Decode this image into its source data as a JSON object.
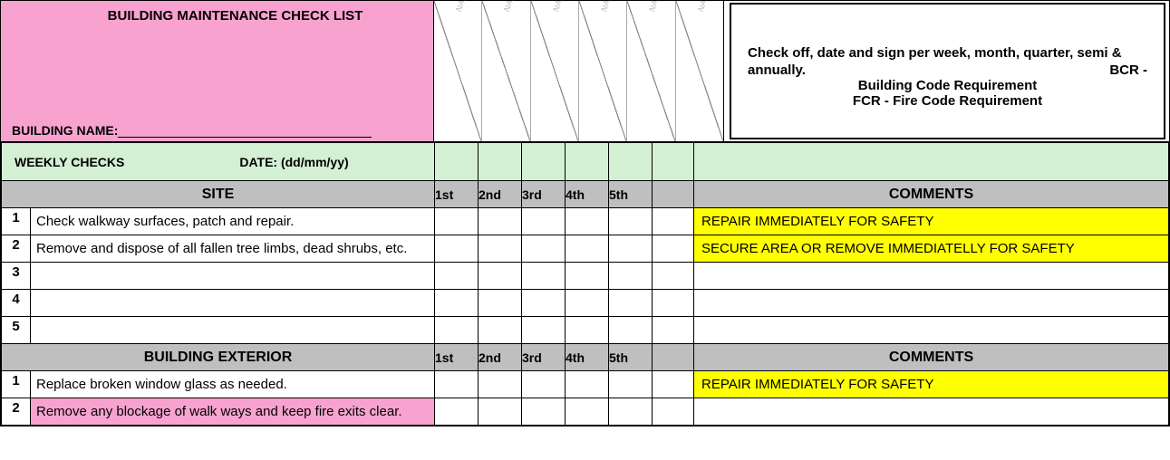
{
  "header": {
    "title": "BUILDING MAINTENANCE CHECK LIST",
    "building_name_label": "BUILDING NAME:",
    "diag_labels": [
      "NAME",
      "NAME",
      "NAME",
      "NAME",
      "NAME",
      "NAME"
    ],
    "info_line1": "Check off, date and sign per week, month, quarter, semi &",
    "info_line2a": "annually.",
    "info_line2b": "BCR -",
    "info_line3": "Building Code Requirement",
    "info_line4": "FCR - Fire Code Requirement"
  },
  "weekly": {
    "label": "WEEKLY CHECKS",
    "date_label": "DATE: (dd/mm/yy)"
  },
  "columns": {
    "c1": "1st",
    "c2": "2nd",
    "c3": "3rd",
    "c4": "4th",
    "c5": "5th",
    "comments": "COMMENTS"
  },
  "sections": [
    {
      "title": "SITE",
      "rows": [
        {
          "num": "1",
          "desc": "Check walkway surfaces, patch and repair.",
          "comment": "REPAIR IMMEDIATELY FOR SAFETY",
          "hl": "yellow",
          "pink": false
        },
        {
          "num": "2",
          "desc": "Remove and dispose of all fallen tree limbs, dead shrubs, etc.",
          "comment": "SECURE AREA OR REMOVE IMMEDIATELLY FOR SAFETY",
          "hl": "yellow",
          "pink": false
        },
        {
          "num": "3",
          "desc": "",
          "comment": "",
          "hl": "",
          "pink": false
        },
        {
          "num": "4",
          "desc": "",
          "comment": "",
          "hl": "",
          "pink": false
        },
        {
          "num": "5",
          "desc": "",
          "comment": "",
          "hl": "",
          "pink": false
        }
      ]
    },
    {
      "title": "BUILDING EXTERIOR",
      "rows": [
        {
          "num": "1",
          "desc": "Replace broken window glass as needed.",
          "comment": "REPAIR IMMEDIATELY FOR SAFETY",
          "hl": "yellow",
          "pink": false
        },
        {
          "num": "2",
          "desc": "Remove any blockage of walk ways and keep fire exits clear.",
          "comment": "",
          "hl": "",
          "pink": true
        }
      ]
    }
  ]
}
